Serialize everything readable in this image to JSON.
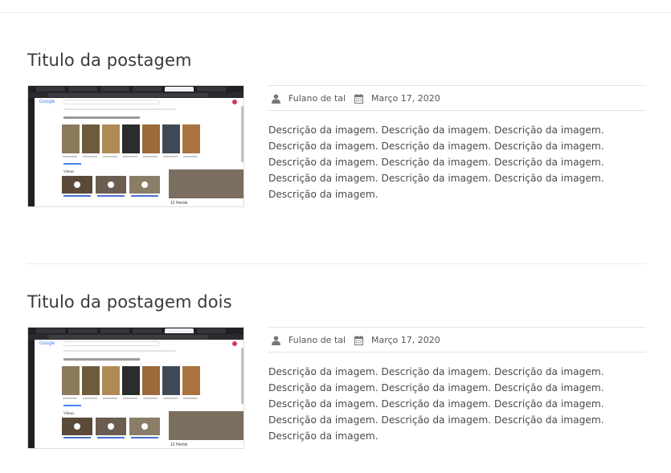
{
  "posts": [
    {
      "title": "Titulo da postagem",
      "author": "Fulano de tal",
      "date": "Março 17, 2020",
      "description": "Descrição da imagem. Descrição da imagem. Descrição da imagem. Descrição da imagem. Descrição da imagem. Descrição da imagem. Descrição da imagem. Descrição da imagem. Descrição da imagem. Descrição da imagem. Descrição da imagem. Descrição da imagem. Descrição da imagem.",
      "thumbnail": {
        "logo_text": "Google",
        "videos_label": "Vídeos",
        "panel_title": "12 Heróis"
      }
    },
    {
      "title": "Titulo da postagem dois",
      "author": "Fulano de tal",
      "date": "Março 17, 2020",
      "description": "Descrição da imagem. Descrição da imagem. Descrição da imagem. Descrição da imagem. Descrição da imagem. Descrição da imagem. Descrição da imagem. Descrição da imagem. Descrição da imagem. Descrição da imagem. Descrição da imagem. Descrição da imagem. Descrição da imagem.",
      "thumbnail": {
        "logo_text": "Google",
        "videos_label": "Vídeos",
        "panel_title": "12 Heróis"
      }
    }
  ],
  "icons": {
    "author": "user-icon",
    "date": "calendar-icon"
  },
  "colors": {
    "meta_icon": "#777777",
    "title": "#3a3a3a",
    "divider": "#ececec"
  }
}
